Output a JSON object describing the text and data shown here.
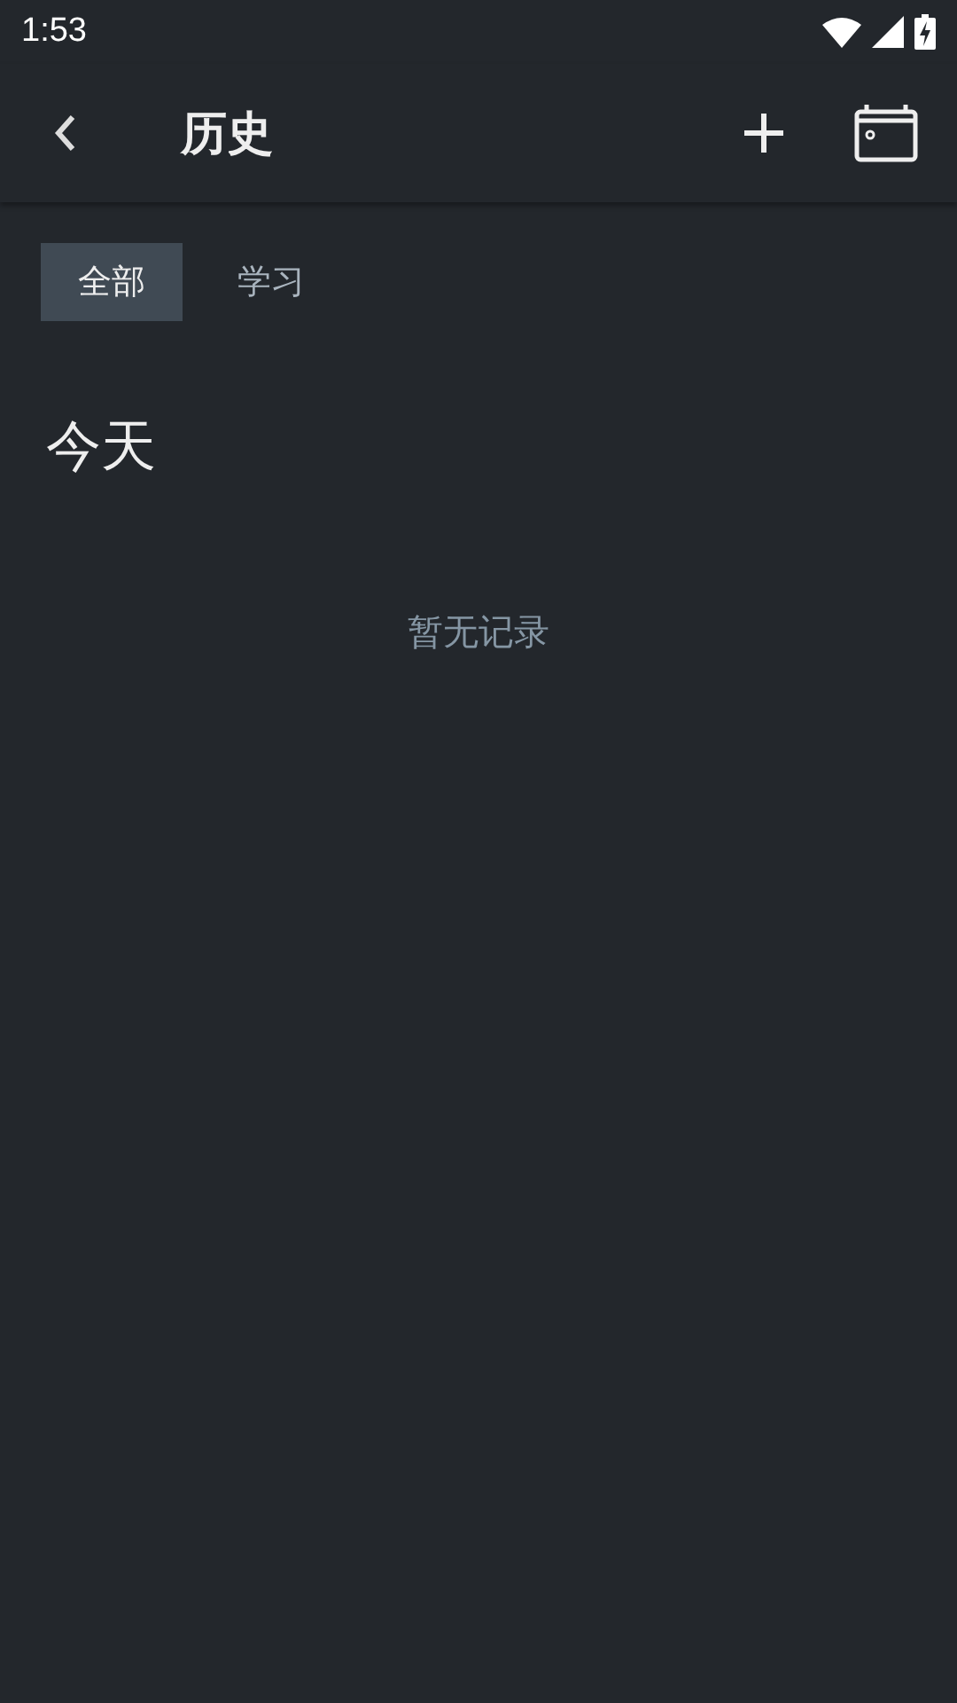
{
  "status_bar": {
    "time": "1:53"
  },
  "app_bar": {
    "title": "历史"
  },
  "tabs": [
    {
      "label": "全部",
      "selected": true
    },
    {
      "label": "学习",
      "selected": false
    }
  ],
  "section": {
    "title": "今天",
    "empty_text": "暂无记录"
  }
}
